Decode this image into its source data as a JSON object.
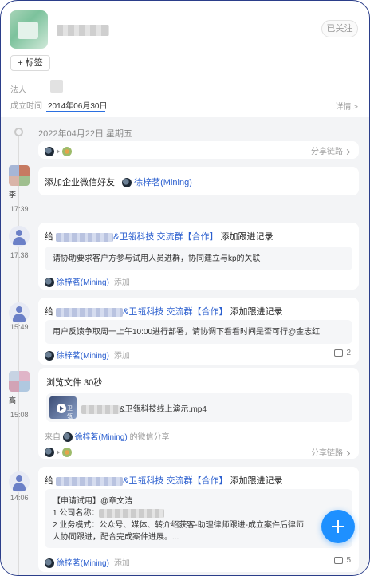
{
  "header": {
    "follow_label": "已关注",
    "tag_label": "+ 标签",
    "legal_person_label": "法人",
    "founded_label": "成立时间",
    "founded_value": "2014年06月30日",
    "detail_label": "详情 >"
  },
  "timeline": {
    "day_header": "2022年04月22日 星期五",
    "share_label": "分享链路",
    "entries": [
      {
        "time": "",
        "share": "分享链路"
      },
      {
        "left_name": "李",
        "time": "17:39",
        "text": "添加企业微信好友",
        "author": "徐梓茗(Mining)"
      },
      {
        "time": "17:38",
        "prefix": "给",
        "group": "&卫瓴科技 交流群【合作】",
        "action": "添加跟进记录",
        "note": "请协助要求客户方参与试用人员进群，协同建立与kp的关联",
        "author": "徐梓茗(Mining)",
        "add": "添加"
      },
      {
        "time": "15:49",
        "prefix": "给",
        "group": "&卫瓴科技 交流群【合作】",
        "action": "添加跟进记录",
        "note": "用户反馈争取周一上午10:00进行部署，请协调下看看时间是否可行@金志红",
        "author": "徐梓茗(Mining)",
        "add": "添加",
        "comments": "2"
      },
      {
        "left_name": "高",
        "time": "15:08",
        "text": "浏览文件 30秒",
        "file_name": "&卫瓴科技线上演示.mp4",
        "thumb_label": "卫瓴",
        "from_prefix": "来自",
        "author": "徐梓茗(Mining)",
        "from_suffix": "的微信分享",
        "share": "分享链路"
      },
      {
        "time": "14:06",
        "prefix": "给",
        "group": "&卫瓴科技 交流群【合作】",
        "action": "添加跟进记录",
        "note_lines": [
          "【申请试用】@章文洁",
          "1 公司名称：",
          "2 业务模式：公众号、媒体、转介绍获客-助理律师跟进-成立案件后律师",
          "人协同跟进，配合完成案件进展。..."
        ],
        "author": "徐梓茗(Mining)",
        "add": "添加",
        "comments": "5"
      }
    ]
  },
  "colors": {
    "accent": "#1e90ff",
    "link_blue": "#2b5fcf",
    "frame": "#2b3e8a"
  }
}
